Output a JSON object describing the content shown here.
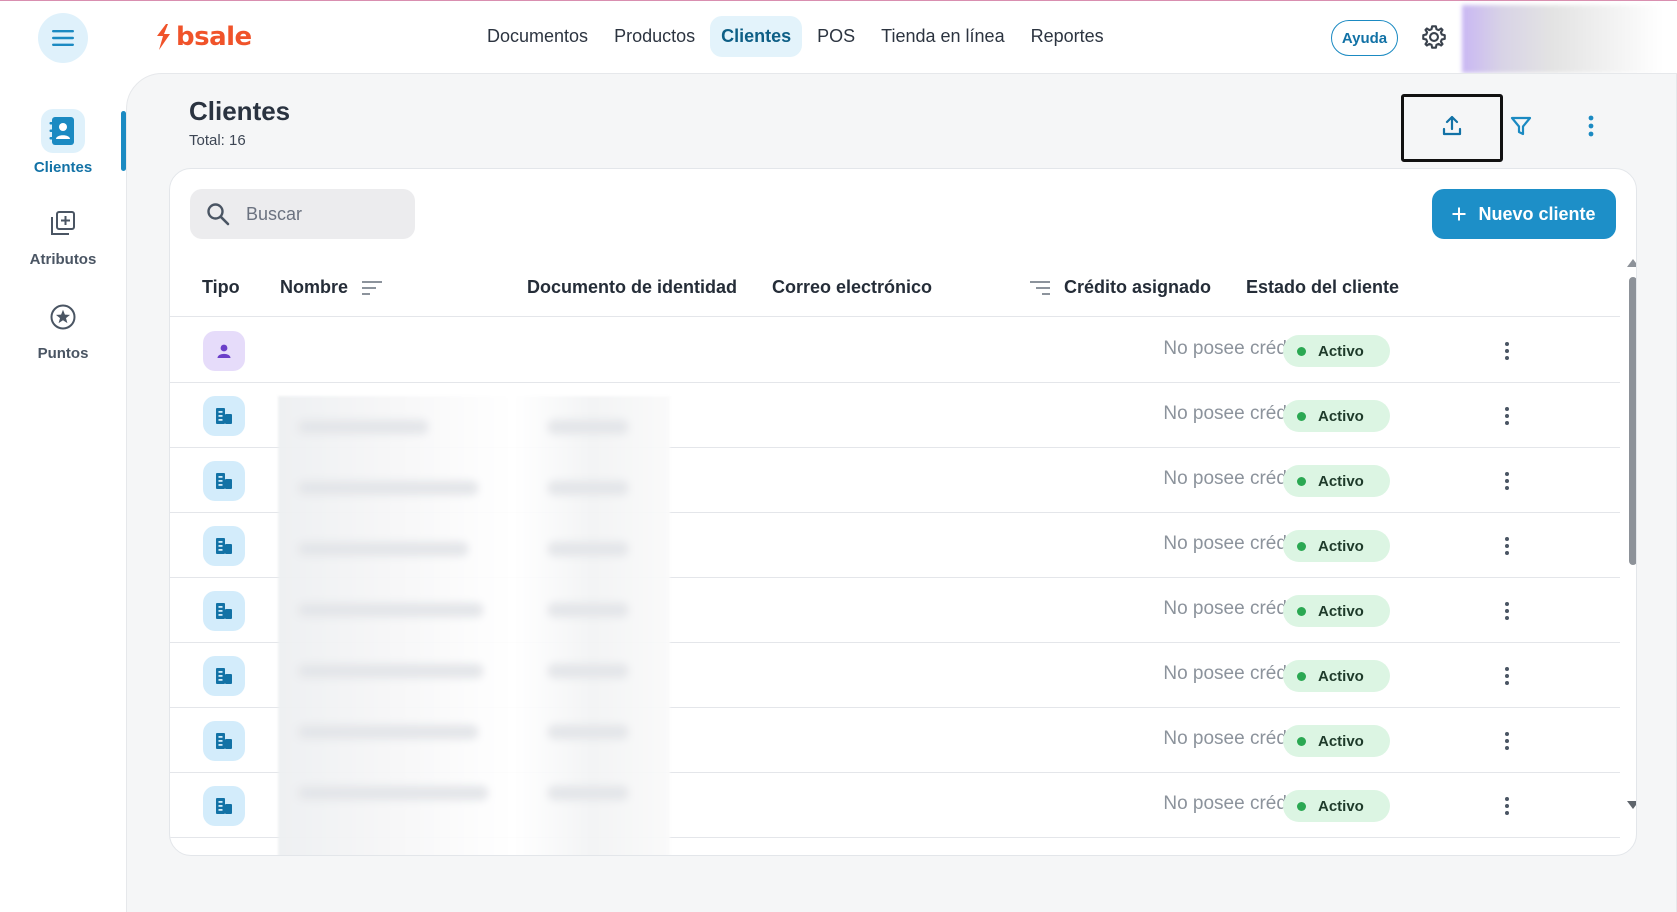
{
  "topbar": {
    "logo_text": "bsale",
    "nav": [
      "Documentos",
      "Productos",
      "Clientes",
      "POS",
      "Tienda en línea",
      "Reportes"
    ],
    "active_nav": "Clientes",
    "help_label": "Ayuda"
  },
  "sidebar": {
    "items": [
      {
        "label": "Clientes",
        "icon": "contacts-icon"
      },
      {
        "label": "Atributos",
        "icon": "add-attribute-icon"
      },
      {
        "label": "Puntos",
        "icon": "star-points-icon"
      }
    ]
  },
  "page": {
    "title": "Clientes",
    "subtitle": "Total: 16"
  },
  "toolbar": {
    "search_placeholder": "Buscar",
    "new_button": "Nuevo cliente"
  },
  "table": {
    "columns": {
      "tipo": "Tipo",
      "nombre": "Nombre",
      "documento": "Documento de identidad",
      "correo": "Correo electrónico",
      "credito": "Crédito asignado",
      "estado": "Estado del cliente"
    },
    "rows": [
      {
        "type": "person",
        "credit": "No posee crédito",
        "status": "Activo"
      },
      {
        "type": "company",
        "credit": "No posee crédito",
        "status": "Activo"
      },
      {
        "type": "company",
        "credit": "No posee crédito",
        "status": "Activo"
      },
      {
        "type": "company",
        "credit": "No posee crédito",
        "status": "Activo"
      },
      {
        "type": "company",
        "credit": "No posee crédito",
        "status": "Activo"
      },
      {
        "type": "company",
        "credit": "No posee crédito",
        "status": "Activo"
      },
      {
        "type": "company",
        "credit": "No posee crédito",
        "status": "Activo"
      },
      {
        "type": "company",
        "credit": "No posee crédito",
        "status": "Activo"
      }
    ]
  },
  "colors": {
    "accent": "#1d8fc8",
    "brand": "#f0532a",
    "status_active": "#2aa852"
  }
}
